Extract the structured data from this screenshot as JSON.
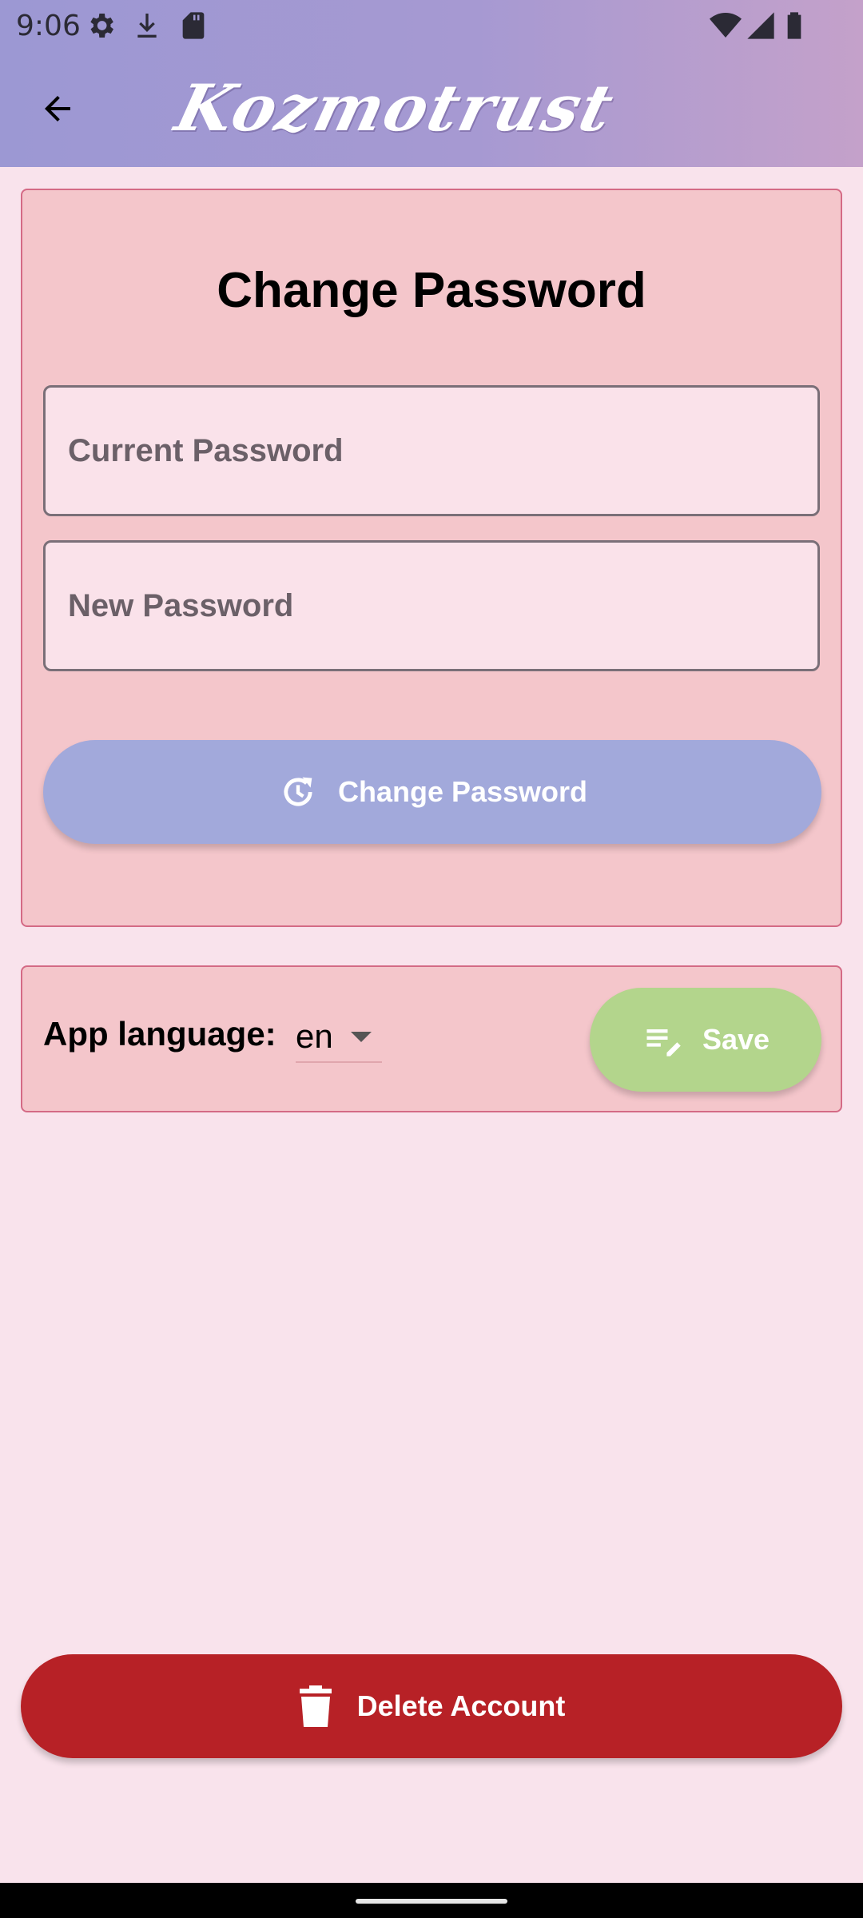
{
  "status_bar": {
    "time": "9:06",
    "left_icons": [
      "gear-icon",
      "download-icon",
      "sd-card-icon"
    ],
    "right_icons": [
      "wifi-icon",
      "signal-icon",
      "battery-icon"
    ]
  },
  "app_bar": {
    "back_icon": "arrow-left-icon",
    "logo_text": "Kozmotrust"
  },
  "change_password": {
    "title": "Change Password",
    "current_password_placeholder": "Current Password",
    "new_password_placeholder": "New Password",
    "button_label": "Change Password",
    "button_icon": "restore-clock-icon"
  },
  "language": {
    "label": "App language:",
    "selected": "en",
    "save_label": "Save",
    "save_icon": "edit-note-icon"
  },
  "delete": {
    "label": "Delete Account",
    "icon": "trash-icon"
  },
  "colors": {
    "app_bar_start": "#9c98d3",
    "app_bar_end": "#c4a1ca",
    "background": "#f9e3ec",
    "card": "#f4c6cb",
    "card_border": "#d46a85",
    "change_button": "#a2a9db",
    "save_button": "#b3d58c",
    "delete_button": "#b72126"
  }
}
